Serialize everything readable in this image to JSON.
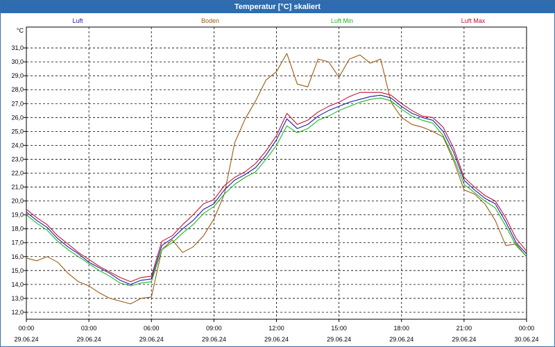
{
  "window": {
    "title": "Temperatur [°C] skaliert"
  },
  "chart_data": {
    "type": "line",
    "title": "Temperatur [°C] skaliert",
    "ylabel": "°C",
    "xlabel": "",
    "ylim": [
      11.5,
      32.5
    ],
    "xlim": [
      0,
      24
    ],
    "grid": true,
    "legend_placement": "top",
    "y_ticks": [
      "12,0",
      "13,0",
      "14,0",
      "15,0",
      "16,0",
      "17,0",
      "18,0",
      "19,0",
      "20,0",
      "21,0",
      "22,0",
      "23,0",
      "24,0",
      "25,0",
      "26,0",
      "27,0",
      "28,0",
      "29,0",
      "30,0",
      "31,0"
    ],
    "x_ticks": [
      {
        "time": "00:00",
        "date": "29.06.24"
      },
      {
        "time": "03:00",
        "date": "29.06.24"
      },
      {
        "time": "06:00",
        "date": "29.06.24"
      },
      {
        "time": "09:00",
        "date": "29.06.24"
      },
      {
        "time": "12:00",
        "date": "29.06.24"
      },
      {
        "time": "15:00",
        "date": "29.06.24"
      },
      {
        "time": "18:00",
        "date": "29.06.24"
      },
      {
        "time": "21:00",
        "date": "29.06.24"
      },
      {
        "time": "00:00",
        "date": "30.06.24"
      }
    ],
    "series": [
      {
        "name": "Luft",
        "color": "#1a1aa8",
        "points": [
          [
            0,
            19.2
          ],
          [
            0.5,
            18.6
          ],
          [
            1,
            18.1
          ],
          [
            1.5,
            17.3
          ],
          [
            2,
            16.7
          ],
          [
            2.5,
            16.2
          ],
          [
            3,
            15.6
          ],
          [
            3.5,
            15.2
          ],
          [
            4,
            14.8
          ],
          [
            4.5,
            14.3
          ],
          [
            5,
            14.0
          ],
          [
            5.5,
            14.3
          ],
          [
            6,
            14.4
          ],
          [
            6.5,
            16.8
          ],
          [
            7,
            17.3
          ],
          [
            7.5,
            18.0
          ],
          [
            8,
            18.6
          ],
          [
            8.5,
            19.4
          ],
          [
            9,
            19.8
          ],
          [
            9.5,
            20.8
          ],
          [
            10,
            21.5
          ],
          [
            10.5,
            21.9
          ],
          [
            11,
            22.4
          ],
          [
            11.5,
            23.3
          ],
          [
            12,
            24.4
          ],
          [
            12.5,
            25.9
          ],
          [
            13,
            25.2
          ],
          [
            13.5,
            25.5
          ],
          [
            14,
            26.1
          ],
          [
            14.5,
            26.5
          ],
          [
            15,
            26.8
          ],
          [
            15.5,
            27.1
          ],
          [
            16,
            27.3
          ],
          [
            16.5,
            27.5
          ],
          [
            17,
            27.6
          ],
          [
            17.5,
            27.4
          ],
          [
            18,
            26.8
          ],
          [
            18.5,
            26.3
          ],
          [
            19,
            26.0
          ],
          [
            19.5,
            25.8
          ],
          [
            20,
            25.0
          ],
          [
            20.5,
            23.5
          ],
          [
            21,
            21.5
          ],
          [
            21.5,
            20.8
          ],
          [
            22,
            20.2
          ],
          [
            22.5,
            19.8
          ],
          [
            23,
            18.5
          ],
          [
            23.5,
            17.0
          ],
          [
            24,
            16.2
          ]
        ]
      },
      {
        "name": "Boden",
        "color": "#9a5a10",
        "points": [
          [
            0,
            15.9
          ],
          [
            0.5,
            15.7
          ],
          [
            1,
            16.0
          ],
          [
            1.5,
            15.6
          ],
          [
            2,
            14.8
          ],
          [
            2.5,
            14.2
          ],
          [
            3,
            13.9
          ],
          [
            3.5,
            13.4
          ],
          [
            4,
            13.0
          ],
          [
            4.5,
            12.8
          ],
          [
            5,
            12.6
          ],
          [
            5.5,
            13.0
          ],
          [
            6,
            13.1
          ],
          [
            6.5,
            16.5
          ],
          [
            7,
            17.2
          ],
          [
            7.5,
            16.3
          ],
          [
            8,
            16.7
          ],
          [
            8.5,
            17.5
          ],
          [
            9,
            18.7
          ],
          [
            9.5,
            20.5
          ],
          [
            10,
            24.2
          ],
          [
            10.5,
            25.9
          ],
          [
            11,
            27.2
          ],
          [
            11.5,
            28.7
          ],
          [
            12,
            29.3
          ],
          [
            12.5,
            30.6
          ],
          [
            13,
            28.4
          ],
          [
            13.5,
            28.2
          ],
          [
            14,
            30.2
          ],
          [
            14.5,
            30.0
          ],
          [
            15,
            28.9
          ],
          [
            15.5,
            30.2
          ],
          [
            16,
            30.5
          ],
          [
            16.5,
            29.9
          ],
          [
            17,
            30.2
          ],
          [
            17.5,
            27.1
          ],
          [
            18,
            26.0
          ],
          [
            18.5,
            25.5
          ],
          [
            19,
            25.3
          ],
          [
            19.5,
            25.0
          ],
          [
            20,
            24.6
          ],
          [
            20.5,
            22.9
          ],
          [
            21,
            20.8
          ],
          [
            21.5,
            20.5
          ],
          [
            22,
            19.8
          ],
          [
            22.5,
            18.6
          ],
          [
            23,
            16.8
          ],
          [
            23.5,
            16.9
          ],
          [
            24,
            16.0
          ]
        ]
      },
      {
        "name": "Luft Min",
        "color": "#1fb51f",
        "points": [
          [
            0,
            19.0
          ],
          [
            0.5,
            18.4
          ],
          [
            1,
            17.9
          ],
          [
            1.5,
            17.1
          ],
          [
            2,
            16.5
          ],
          [
            2.5,
            16.0
          ],
          [
            3,
            15.5
          ],
          [
            3.5,
            15.0
          ],
          [
            4,
            14.6
          ],
          [
            4.5,
            14.1
          ],
          [
            5,
            13.9
          ],
          [
            5.5,
            14.1
          ],
          [
            6,
            14.2
          ],
          [
            6.5,
            16.5
          ],
          [
            7,
            17.0
          ],
          [
            7.5,
            17.7
          ],
          [
            8,
            18.3
          ],
          [
            8.5,
            19.1
          ],
          [
            9,
            19.6
          ],
          [
            9.5,
            20.5
          ],
          [
            10,
            21.2
          ],
          [
            10.5,
            21.7
          ],
          [
            11,
            22.1
          ],
          [
            11.5,
            23.0
          ],
          [
            12,
            24.0
          ],
          [
            12.5,
            25.4
          ],
          [
            13,
            24.9
          ],
          [
            13.5,
            25.2
          ],
          [
            14,
            25.8
          ],
          [
            14.5,
            26.1
          ],
          [
            15,
            26.5
          ],
          [
            15.5,
            26.8
          ],
          [
            16,
            27.1
          ],
          [
            16.5,
            27.3
          ],
          [
            17,
            27.4
          ],
          [
            17.5,
            27.2
          ],
          [
            18,
            26.6
          ],
          [
            18.5,
            26.1
          ],
          [
            19,
            25.8
          ],
          [
            19.5,
            25.6
          ],
          [
            20,
            24.7
          ],
          [
            20.5,
            23.1
          ],
          [
            21,
            21.2
          ],
          [
            21.5,
            20.6
          ],
          [
            22,
            20.0
          ],
          [
            22.5,
            19.5
          ],
          [
            23,
            18.2
          ],
          [
            23.5,
            16.8
          ],
          [
            24,
            16.0
          ]
        ]
      },
      {
        "name": "Luft Max",
        "color": "#c01030",
        "points": [
          [
            0,
            19.4
          ],
          [
            0.5,
            18.8
          ],
          [
            1,
            18.3
          ],
          [
            1.5,
            17.5
          ],
          [
            2,
            16.9
          ],
          [
            2.5,
            16.3
          ],
          [
            3,
            15.8
          ],
          [
            3.5,
            15.3
          ],
          [
            4,
            14.9
          ],
          [
            4.5,
            14.5
          ],
          [
            5,
            14.2
          ],
          [
            5.5,
            14.5
          ],
          [
            6,
            14.6
          ],
          [
            6.5,
            17.1
          ],
          [
            7,
            17.5
          ],
          [
            7.5,
            18.3
          ],
          [
            8,
            19.0
          ],
          [
            8.5,
            19.8
          ],
          [
            9,
            20.1
          ],
          [
            9.5,
            21.1
          ],
          [
            10,
            21.7
          ],
          [
            10.5,
            22.1
          ],
          [
            11,
            22.7
          ],
          [
            11.5,
            23.6
          ],
          [
            12,
            24.7
          ],
          [
            12.5,
            26.3
          ],
          [
            13,
            25.5
          ],
          [
            13.5,
            25.8
          ],
          [
            14,
            26.4
          ],
          [
            14.5,
            26.8
          ],
          [
            15,
            27.1
          ],
          [
            15.5,
            27.5
          ],
          [
            16,
            27.8
          ],
          [
            16.5,
            27.8
          ],
          [
            17,
            27.8
          ],
          [
            17.5,
            27.6
          ],
          [
            18,
            27.0
          ],
          [
            18.5,
            26.5
          ],
          [
            19,
            26.1
          ],
          [
            19.5,
            26.0
          ],
          [
            20,
            25.3
          ],
          [
            20.5,
            23.8
          ],
          [
            21,
            21.7
          ],
          [
            21.5,
            21.0
          ],
          [
            22,
            20.4
          ],
          [
            22.5,
            20.0
          ],
          [
            23,
            18.8
          ],
          [
            23.5,
            17.3
          ],
          [
            24,
            16.4
          ]
        ]
      }
    ]
  }
}
